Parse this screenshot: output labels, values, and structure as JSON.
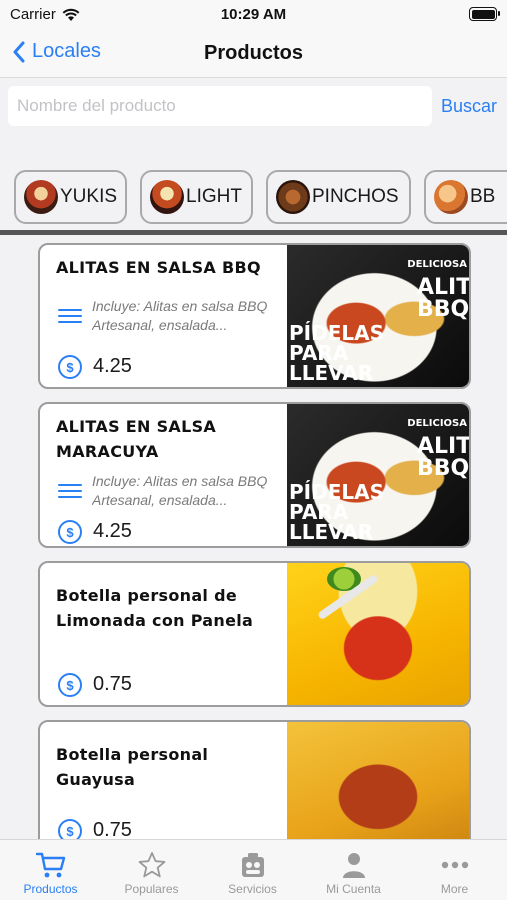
{
  "status_bar": {
    "carrier": "Carrier",
    "time": "10:29 AM"
  },
  "nav": {
    "back_label": "Locales",
    "title": "Productos"
  },
  "search": {
    "placeholder": "Nombre del producto",
    "button_label": "Buscar"
  },
  "categories": [
    {
      "label": "YUKIS",
      "icon": "yukis-thumbnail"
    },
    {
      "label": "LIGHT",
      "icon": "light-thumbnail"
    },
    {
      "label": "PINCHOS",
      "icon": "pinchos-thumbnail"
    },
    {
      "label": "BB",
      "icon": "bb-thumbnail"
    }
  ],
  "products": [
    {
      "name": "ALITAS EN SALSA BBQ",
      "description": "Incluye: Alitas en salsa BBQ Artesanal, ensalada...",
      "price": "4.25",
      "image_text": {
        "top": "DELICIOSA",
        "main": "ALITA BBQ",
        "bottom": "PÍDELAS PARA LLEVAR"
      }
    },
    {
      "name": "ALITAS EN SALSA MARACUYA",
      "description": "Incluye: Alitas en salsa BBQ Artesanal, ensalada...",
      "price": "4.25",
      "image_text": {
        "top": "DELICIOSA",
        "main": "ALITA BBQ",
        "bottom": "PÍDELAS PARA LLEVAR"
      }
    },
    {
      "name": "Botella personal de Limonada con Panela",
      "price": "0.75"
    },
    {
      "name": "Botella personal Guayusa",
      "price": "0.75"
    }
  ],
  "tabs": [
    {
      "label": "Productos",
      "icon": "cart-icon",
      "active": true
    },
    {
      "label": "Populares",
      "icon": "star-icon",
      "active": false
    },
    {
      "label": "Servicios",
      "icon": "services-icon",
      "active": false
    },
    {
      "label": "Mi Cuenta",
      "icon": "person-icon",
      "active": false
    },
    {
      "label": "More",
      "icon": "more-icon",
      "active": false
    }
  ],
  "colors": {
    "accent": "#2a7ff5",
    "tab_inactive": "#9a9a9a",
    "card_border": "#9c9c9c"
  }
}
